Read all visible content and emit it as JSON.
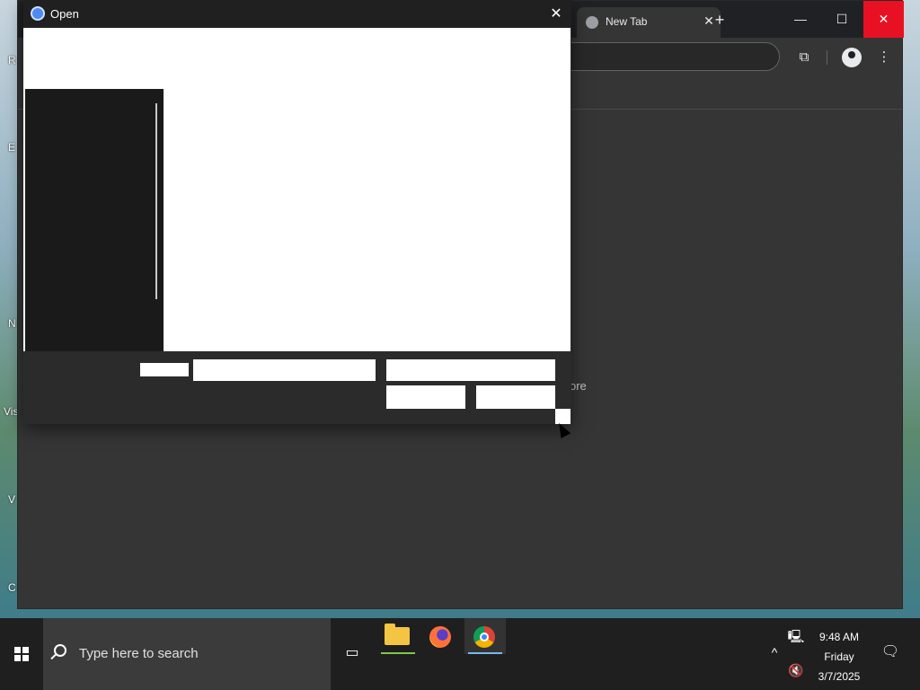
{
  "desktop": {
    "labels": [
      "R",
      "E",
      "N",
      "Vis",
      "V",
      "C"
    ]
  },
  "browser": {
    "tab_title": "New Tab",
    "tab_close": "✕",
    "new_tab": "+",
    "minimize": "—",
    "maximize": "☐",
    "close": "✕",
    "extensions_icon": "⧉",
    "menu_icon": "⋮",
    "partial_text": "ore"
  },
  "dialog": {
    "title": "Open",
    "close": "✕"
  },
  "taskbar": {
    "search_placeholder": "Type here to search",
    "taskview_icon": "▭",
    "tray_chevron": "^",
    "network_icon": "🖳",
    "volume_icon": "🔇",
    "notif_icon": "🗨",
    "clock": {
      "time": "9:48 AM",
      "day": "Friday",
      "date": "3/7/2025"
    }
  },
  "colors": {
    "close_red": "#e81123",
    "explorer_underline": "#7ec84a",
    "chrome_underline": "#76b9ed"
  }
}
